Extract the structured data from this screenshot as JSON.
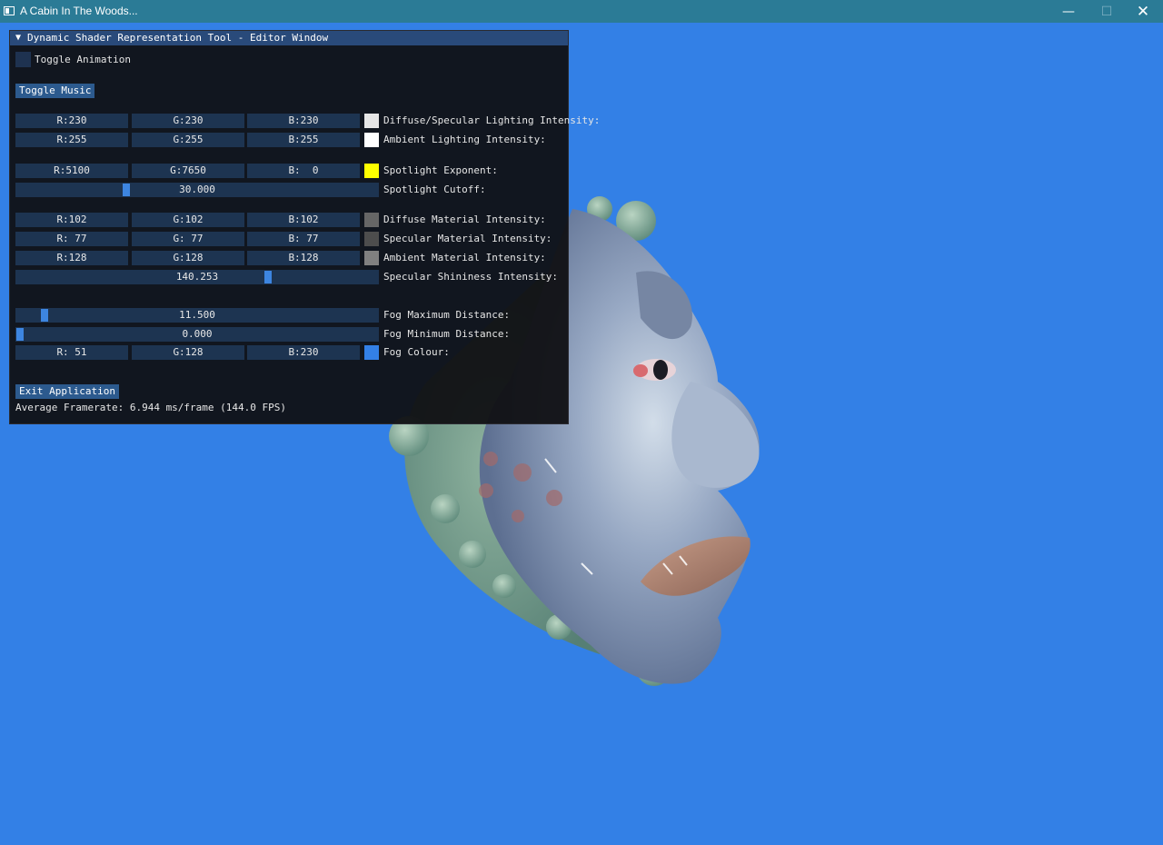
{
  "window": {
    "title": "A Cabin In The Woods...",
    "minimize": "—",
    "maximize": "☐",
    "close": "✕"
  },
  "editor": {
    "title": "Dynamic Shader Representation Tool - Editor Window",
    "collapse_arrow": "▼",
    "toggle_animation": "Toggle Animation",
    "toggle_music": "Toggle Music",
    "exit_button": "Exit Application",
    "framerate": "Average Framerate: 6.944 ms/frame (144.0 FPS)",
    "rows": {
      "diffuse_specular_light": {
        "r": "R:230",
        "g": "G:230",
        "b": "B:230",
        "label": "Diffuse/Specular Lighting Intensity:",
        "swatch": "#e6e6e6"
      },
      "ambient_light": {
        "r": "R:255",
        "g": "G:255",
        "b": "B:255",
        "label": "Ambient Lighting Intensity:",
        "swatch": "#ffffff"
      },
      "spotlight_exponent": {
        "r": "R:5100",
        "g": "G:7650",
        "b": "B:  0",
        "label": "Spotlight Exponent:",
        "swatch": "#ffff00"
      },
      "spotlight_cutoff": {
        "value": "30.000",
        "label": "Spotlight Cutoff:",
        "fraction": 0.3
      },
      "diffuse_material": {
        "r": "R:102",
        "g": "G:102",
        "b": "B:102",
        "label": "Diffuse Material Intensity:",
        "swatch": "#666666"
      },
      "specular_material": {
        "r": "R: 77",
        "g": "G: 77",
        "b": "B: 77",
        "label": "Specular Material Intensity:",
        "swatch": "#4d4d4d"
      },
      "ambient_material": {
        "r": "R:128",
        "g": "G:128",
        "b": "B:128",
        "label": "Ambient Material Intensity:",
        "swatch": "#808080"
      },
      "specular_shininess": {
        "value": "140.253",
        "label": "Specular Shininess Intensity:",
        "fraction": 0.7
      },
      "fog_max": {
        "value": "11.500",
        "label": "Fog Maximum Distance:",
        "fraction": 0.07
      },
      "fog_min": {
        "value": "0.000",
        "label": "Fog Minimum Distance:",
        "fraction": 0.0
      },
      "fog_colour": {
        "r": "R: 51",
        "g": "G:128",
        "b": "B:230",
        "label": "Fog Colour:",
        "swatch": "#3380e6"
      }
    }
  },
  "colors": {
    "background": "#3380e6",
    "titlebar": "#2b7b96"
  }
}
